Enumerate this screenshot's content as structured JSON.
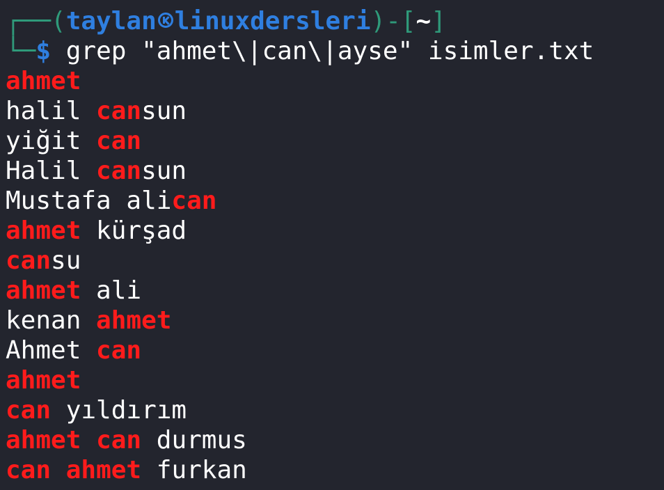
{
  "prompt": {
    "frame_top": "┌──(",
    "user": "taylan",
    "host": "linuxdersleri",
    "frame_mid": ")-[",
    "dir": "~",
    "frame_end": "]",
    "frame_bottom": "└─",
    "dollar": "$",
    "command": " grep \"ahmet\\|can\\|ayse\" isimler.txt"
  },
  "colors": {
    "match": "#ff1b1b",
    "text": "#ffffff",
    "background": "#23252e",
    "prompt_blue": "#2f7fe0",
    "prompt_green": "#2f9a7a"
  },
  "output": [
    [
      {
        "t": "ahmet",
        "m": true
      }
    ],
    [
      {
        "t": "halil ",
        "m": false
      },
      {
        "t": "can",
        "m": true
      },
      {
        "t": "sun",
        "m": false
      }
    ],
    [
      {
        "t": "yiğit ",
        "m": false
      },
      {
        "t": "can",
        "m": true
      }
    ],
    [
      {
        "t": "Halil ",
        "m": false
      },
      {
        "t": "can",
        "m": true
      },
      {
        "t": "sun",
        "m": false
      }
    ],
    [
      {
        "t": "Mustafa ali",
        "m": false
      },
      {
        "t": "can",
        "m": true
      }
    ],
    [
      {
        "t": "ahmet",
        "m": true
      },
      {
        "t": " kürşad",
        "m": false
      }
    ],
    [
      {
        "t": "can",
        "m": true
      },
      {
        "t": "su",
        "m": false
      }
    ],
    [
      {
        "t": "ahmet",
        "m": true
      },
      {
        "t": " ali",
        "m": false
      }
    ],
    [
      {
        "t": "kenan ",
        "m": false
      },
      {
        "t": "ahmet",
        "m": true
      }
    ],
    [
      {
        "t": "Ahmet ",
        "m": false
      },
      {
        "t": "can",
        "m": true
      }
    ],
    [
      {
        "t": "ahmet",
        "m": true
      }
    ],
    [
      {
        "t": "can",
        "m": true
      },
      {
        "t": " yıldırım",
        "m": false
      }
    ],
    [
      {
        "t": "ahmet",
        "m": true
      },
      {
        "t": " ",
        "m": false
      },
      {
        "t": "can",
        "m": true
      },
      {
        "t": " durmus",
        "m": false
      }
    ],
    [
      {
        "t": "can",
        "m": true
      },
      {
        "t": " ",
        "m": false
      },
      {
        "t": "ahmet",
        "m": true
      },
      {
        "t": " furkan",
        "m": false
      }
    ]
  ]
}
